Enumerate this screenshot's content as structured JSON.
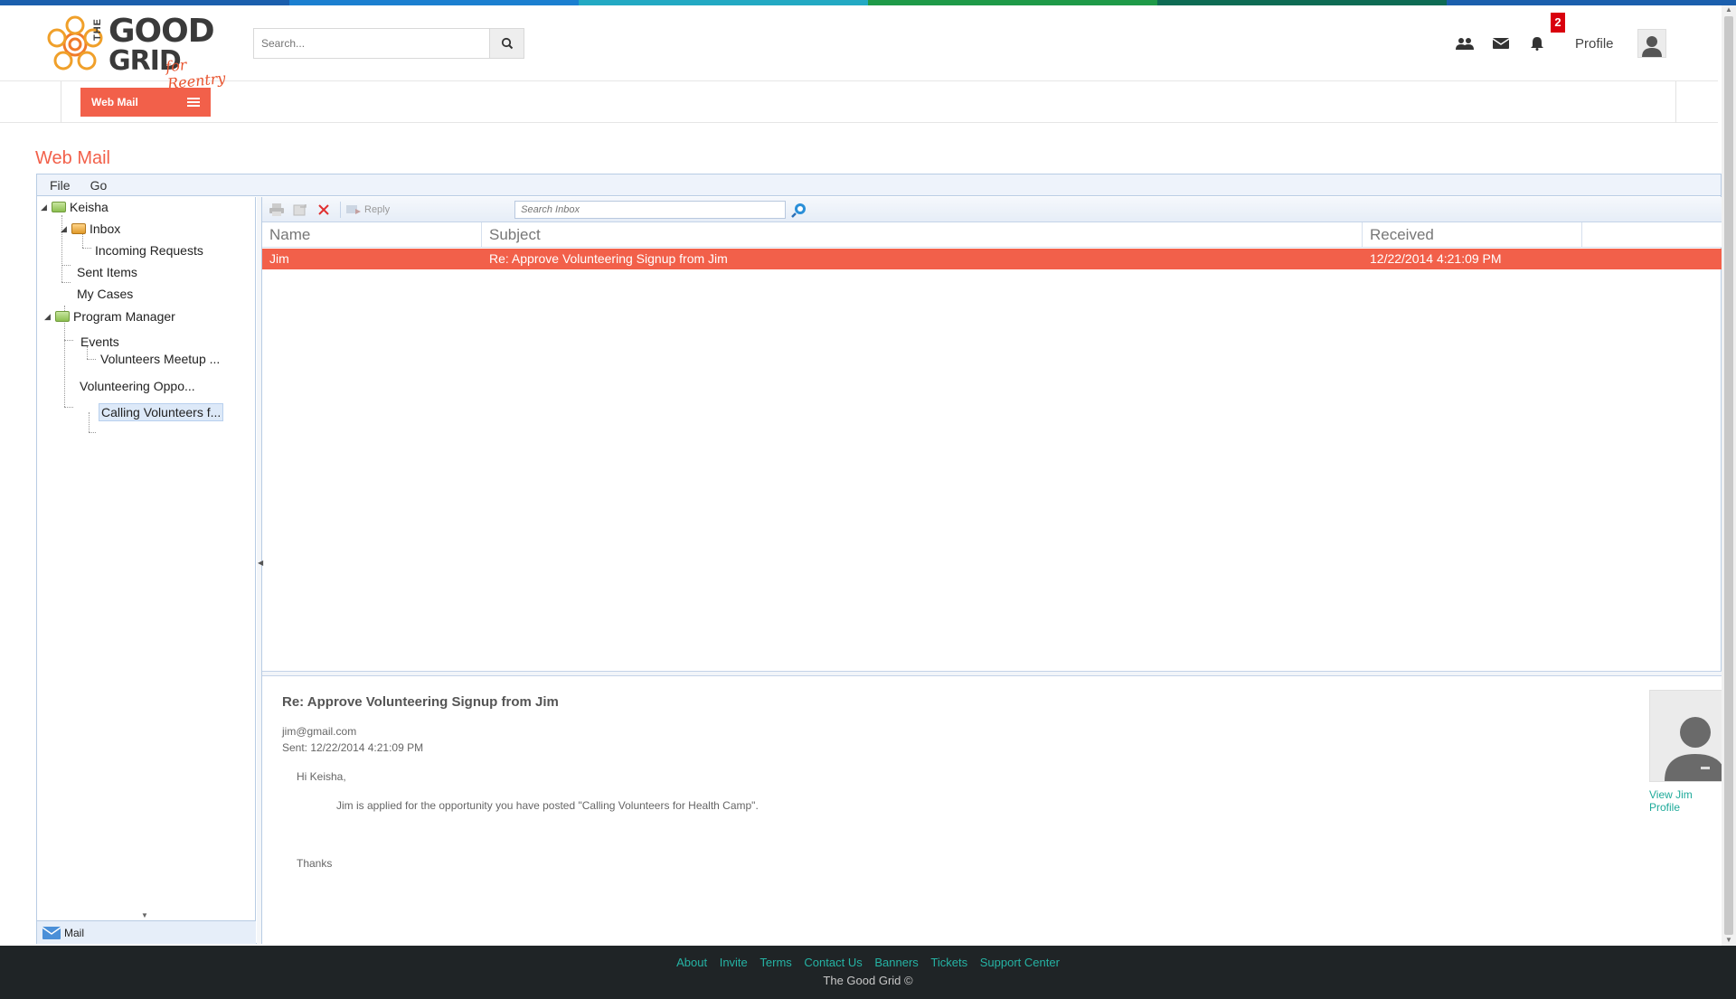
{
  "brand": {
    "the": "THE",
    "word1": "GOOD",
    "word2": "GRID",
    "tagline": "for Reentry",
    "strip_colors": [
      "#1b5fad",
      "#1b7fd0",
      "#23a9c3",
      "#1f9a48",
      "#0e6b54",
      "#1b5fad"
    ]
  },
  "header": {
    "search_placeholder": "Search...",
    "notification_count": "2",
    "profile_label": "Profile",
    "icons": [
      "users-icon",
      "envelope-icon",
      "bell-icon",
      "avatar-icon"
    ]
  },
  "subnav": {
    "webmail_button": "Web Mail",
    "accent_color": "#f2604a"
  },
  "page": {
    "title": "Web Mail"
  },
  "menubar": {
    "items": [
      "File",
      "Go"
    ]
  },
  "tree": {
    "root": "Keisha",
    "inbox": "Inbox",
    "incoming": "Incoming Requests",
    "sent": "Sent Items",
    "cases": "My Cases",
    "program_manager": "Program Manager",
    "events": "Events",
    "volunteers_meetup": "Volunteers Meetup ...",
    "volunteering_oppo": "Volunteering Oppo...",
    "calling_volunteers": "Calling Volunteers f...",
    "mail_tab": "Mail"
  },
  "toolbar": {
    "reply_label": "Reply",
    "search_placeholder": "Search Inbox"
  },
  "grid": {
    "columns": [
      "Name",
      "Subject",
      "Received"
    ],
    "rows": [
      {
        "name": "Jim",
        "subject": "Re: Approve Volunteering Signup from Jim",
        "received": "12/22/2014 4:21:09 PM"
      }
    ]
  },
  "preview": {
    "subject": "Re: Approve Volunteering Signup from Jim",
    "from": "jim@gmail.com",
    "sent": "Sent: 12/22/2014 4:21:09 PM",
    "greeting": "Hi Keisha,",
    "body": "Jim is applied for the opportunity you have posted \"Calling Volunteers for Health Camp\".",
    "signoff": "Thanks",
    "profile_link": "View Jim Profile"
  },
  "footer": {
    "links": [
      "About",
      "Invite",
      "Terms",
      "Contact Us",
      "Banners",
      "Tickets",
      "Support Center"
    ],
    "copyright": "The Good Grid ©"
  }
}
